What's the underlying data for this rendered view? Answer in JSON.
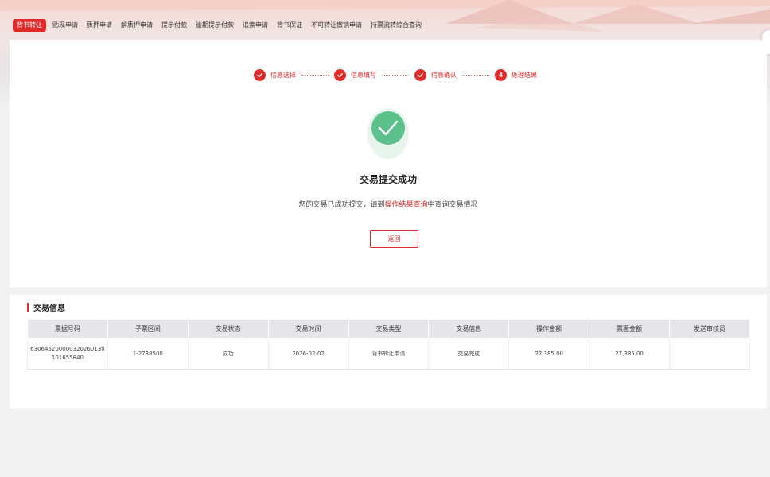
{
  "nav": {
    "items": [
      {
        "label": "背书转让",
        "active": true
      },
      {
        "label": "贴现申请"
      },
      {
        "label": "质押申请"
      },
      {
        "label": "解质押申请"
      },
      {
        "label": "提示付款"
      },
      {
        "label": "逾期提示付款"
      },
      {
        "label": "追索申请"
      },
      {
        "label": "背书保证"
      },
      {
        "label": "不可转让撤销申请"
      },
      {
        "label": "持票流转综合查询"
      }
    ]
  },
  "steps": [
    {
      "label": "信息选择",
      "status": "done"
    },
    {
      "label": "信息填写",
      "status": "done"
    },
    {
      "label": "信息确认",
      "status": "done"
    },
    {
      "label": "处理结果",
      "status": "current",
      "number": "4"
    }
  ],
  "result": {
    "title": "交易提交成功",
    "msg_prefix": "您的交易已成功提交，请到",
    "msg_link": "操作结果查询",
    "msg_suffix": "中查询交易情况",
    "back_label": "返回"
  },
  "info": {
    "title": "交易信息",
    "columns": [
      "票据号码",
      "子票区间",
      "交易状态",
      "交易时间",
      "交易类型",
      "交易信息",
      "操作金额",
      "票面金额",
      "发送审核员"
    ],
    "rows": [
      [
        "630645200000320260130101655840",
        "1-2738500",
        "成功",
        "2026-02-02",
        "背书转让申请",
        "交易完成",
        "27,385.00",
        "27,385.00",
        ""
      ]
    ]
  },
  "colors": {
    "accent": "#e02b2b",
    "success": "#5cc08a"
  }
}
